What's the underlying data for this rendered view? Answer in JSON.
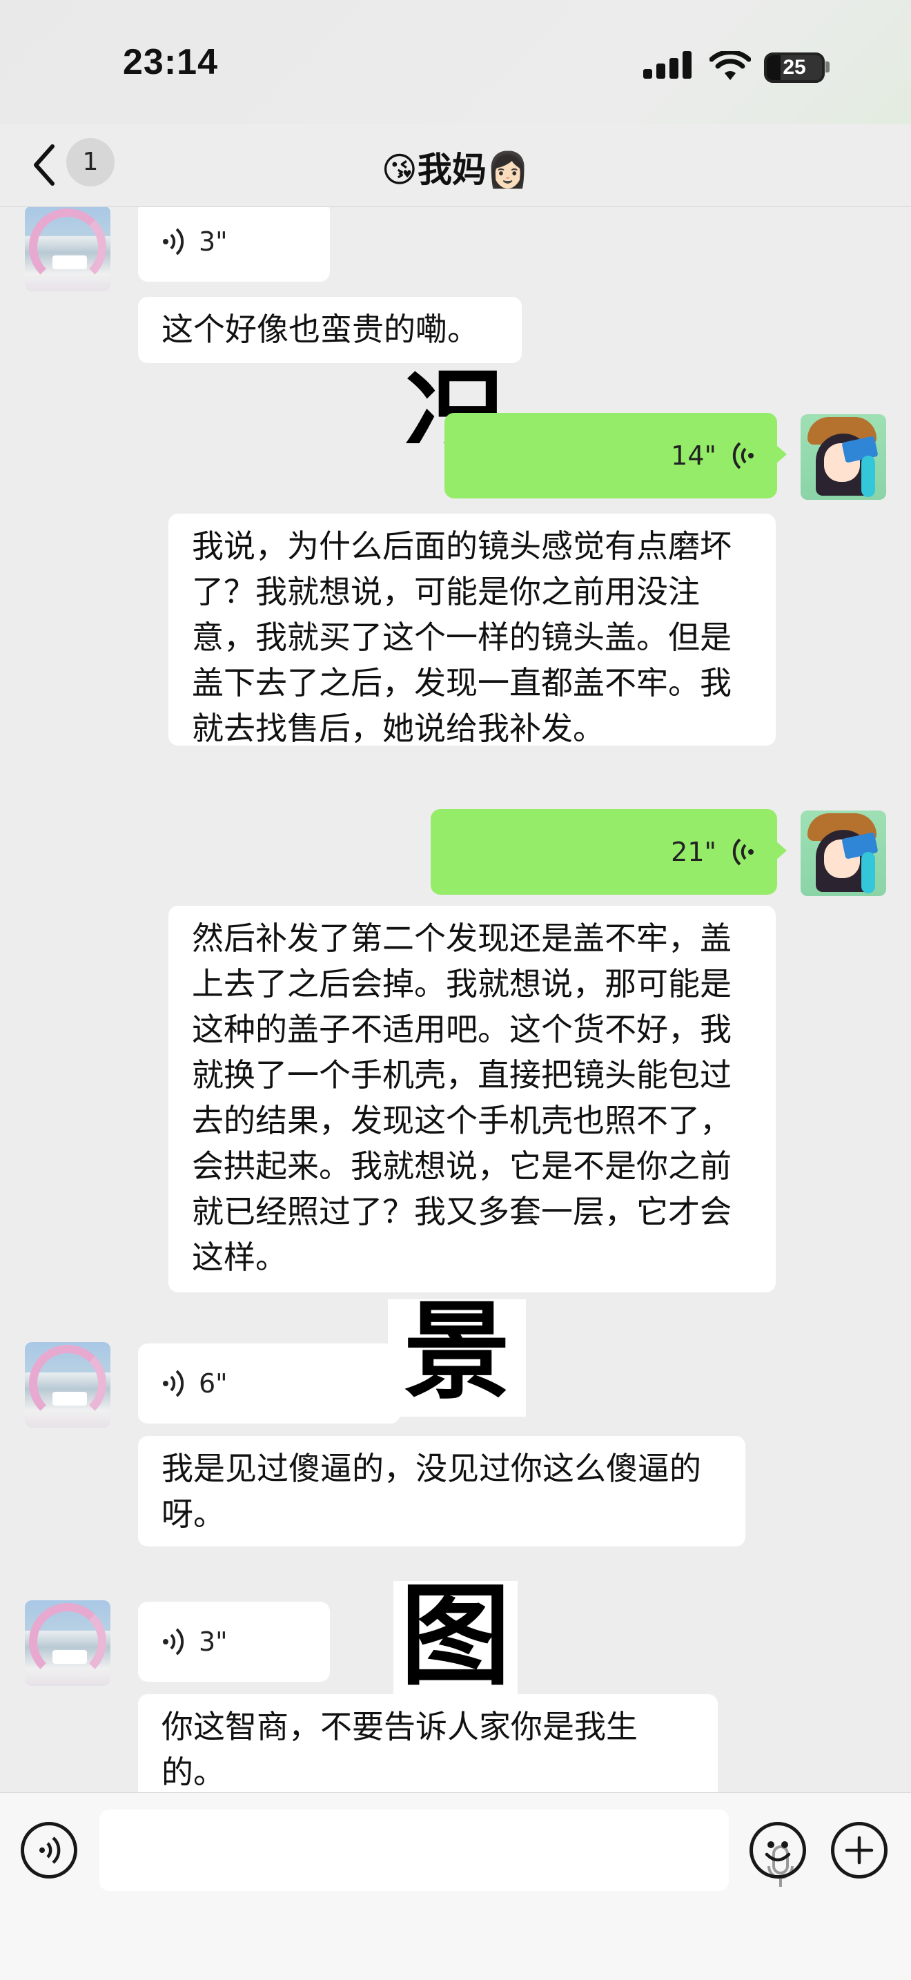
{
  "status_bar": {
    "time": "23:14",
    "battery": "25",
    "battery_level_pct": 25
  },
  "nav": {
    "back_count": "1",
    "title": "😘我妈👩🏻"
  },
  "messages": [
    {
      "side": "left",
      "type": "voice",
      "duration": "3\"",
      "transcript": "这个好像也蛮贵的嘞。"
    },
    {
      "side": "right",
      "type": "voice",
      "duration": "14\"",
      "transcript": "我说，为什么后面的镜头感觉有点磨坏了？我就想说，可能是你之前用没注意，我就买了这个一样的镜头盖。但是盖下去了之后，发现一直都盖不牢。我就去找售后，她说给我补发。"
    },
    {
      "side": "right",
      "type": "voice",
      "duration": "21\"",
      "transcript": "然后补发了第二个发现还是盖不牢，盖上去了之后会掉。我就想说，那可能是这种的盖子不适用吧。这个货不好，我就换了一个手机壳，直接把镜头能包过去的结果，发现这个手机壳也照不了，会拱起来。我就想说，它是不是你之前就已经照过了？我又多套一层，它才会这样。"
    },
    {
      "side": "left",
      "type": "voice",
      "duration": "6\"",
      "transcript": "我是见过傻逼的，没见过你这么傻逼的呀。"
    },
    {
      "side": "left",
      "type": "voice",
      "duration": "3\"",
      "transcript": "你这智商，不要告诉人家你是我生的。"
    }
  ],
  "overlay_chars": [
    "况",
    "景",
    "图"
  ],
  "input_bar": {
    "placeholder": ""
  }
}
